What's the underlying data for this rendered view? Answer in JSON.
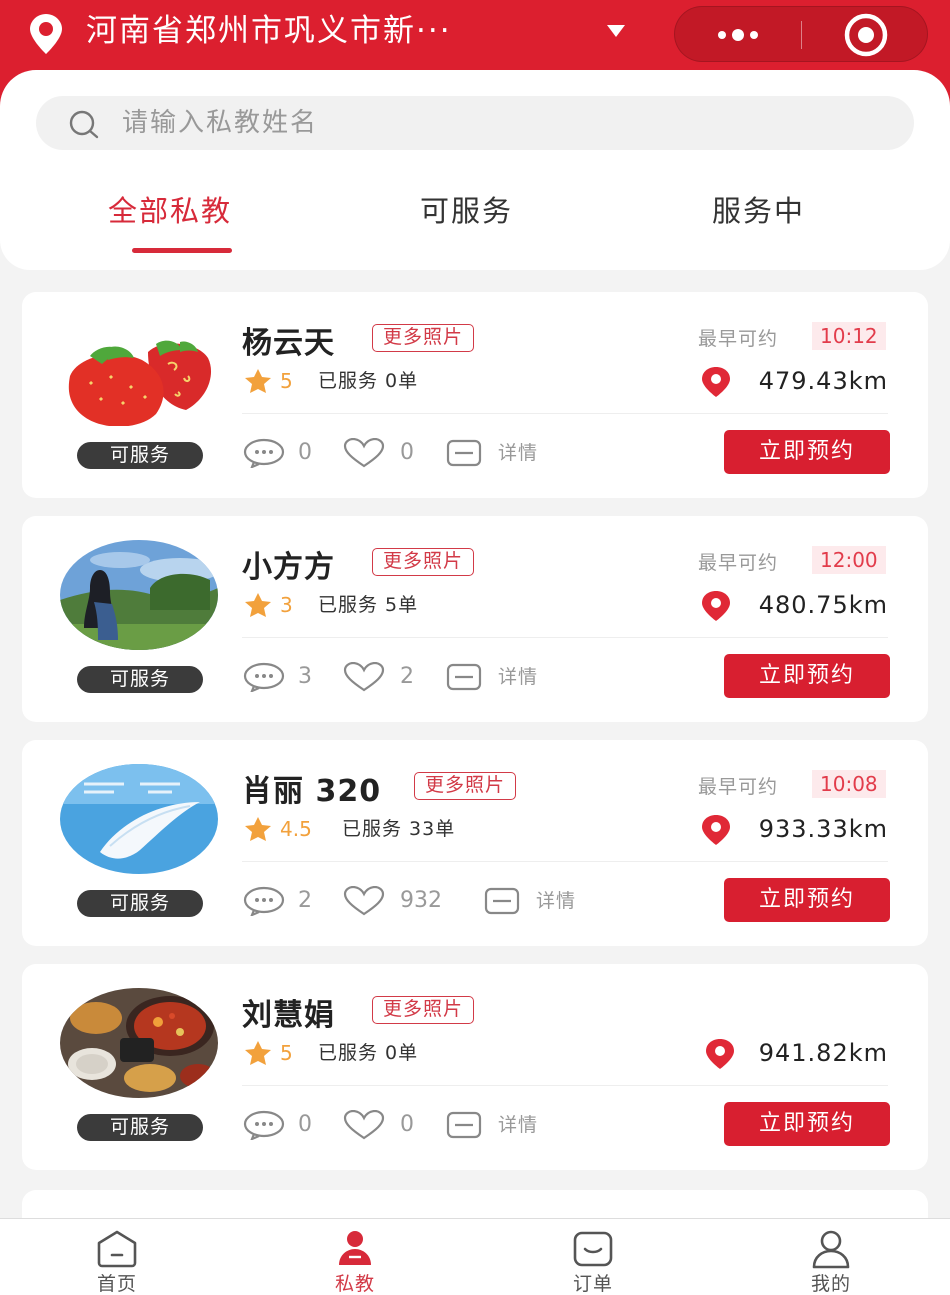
{
  "header": {
    "location": "河南省郑州市巩义市新···",
    "location_icon": "location-pin-icon",
    "dropdown_icon": "triangle-down-icon",
    "capsule_icons": [
      "more-dots-icon",
      "target-icon"
    ],
    "brand_color": "#dc1f2f"
  },
  "search": {
    "placeholder": "请输入私教姓名",
    "value": ""
  },
  "tabs": [
    {
      "label": "全部私教",
      "active": true
    },
    {
      "label": "可服务",
      "active": false
    },
    {
      "label": "服务中",
      "active": false
    }
  ],
  "labels": {
    "more_photos": "更多照片",
    "earliest": "最早可约",
    "detail": "详情",
    "book": "立即预约",
    "served_prefix": "已服务",
    "served_suffix": "单"
  },
  "coaches": [
    {
      "name": "杨云天",
      "rating": "5",
      "served": "已服务 0单",
      "status": "可服务",
      "earliest_time": "10:12",
      "distance": "479.43km",
      "comments": "0",
      "likes": "0",
      "avatar": "strawberry"
    },
    {
      "name": "小方方",
      "rating": "3",
      "served": "已服务 5单",
      "status": "可服务",
      "earliest_time": "12:00",
      "distance": "480.75km",
      "comments": "3",
      "likes": "2",
      "avatar": "person-in-park"
    },
    {
      "name": "肖丽 320",
      "rating": "4.5",
      "served": "已服务 33单",
      "status": "可服务",
      "earliest_time": "10:08",
      "distance": "933.33km",
      "comments": "2",
      "likes": "932",
      "avatar": "feather-5g"
    },
    {
      "name": "刘慧娟",
      "rating": "5",
      "served": "已服务 0单",
      "status": "可服务",
      "earliest_time": "",
      "distance": "941.82km",
      "comments": "0",
      "likes": "0",
      "avatar": "food-table"
    }
  ],
  "tabbar": [
    {
      "label": "首页",
      "icon": "home-icon",
      "active": false
    },
    {
      "label": "私教",
      "icon": "coach-icon",
      "active": true
    },
    {
      "label": "订单",
      "icon": "order-icon",
      "active": false
    },
    {
      "label": "我的",
      "icon": "profile-icon",
      "active": false
    }
  ],
  "colors": {
    "accent": "#d72a3a",
    "star": "#f2a13c",
    "badge_bg": "#3b3b3b"
  }
}
